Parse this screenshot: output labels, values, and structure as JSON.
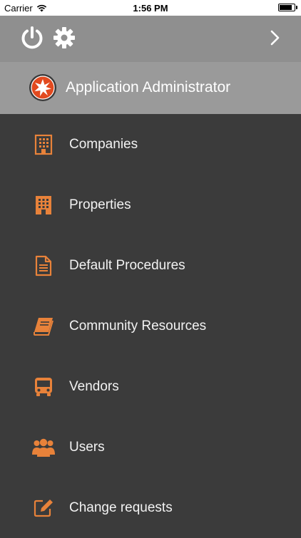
{
  "status_bar": {
    "carrier": "Carrier",
    "time": "1:56 PM",
    "battery_level": 0.85
  },
  "header": {
    "power_icon": "power-icon",
    "settings_icon": "gear-icon",
    "next_icon": "chevron-right-icon"
  },
  "profile": {
    "name": "Application Administrator",
    "avatar_icon": "starburst-logo-icon"
  },
  "menu": {
    "items": [
      {
        "label": "Companies",
        "icon": "office-building-icon"
      },
      {
        "label": "Properties",
        "icon": "apartment-building-icon"
      },
      {
        "label": "Default Procedures",
        "icon": "document-icon"
      },
      {
        "label": "Community Resources",
        "icon": "book-icon"
      },
      {
        "label": "Vendors",
        "icon": "bus-icon"
      },
      {
        "label": "Users",
        "icon": "users-icon"
      },
      {
        "label": "Change requests",
        "icon": "edit-icon"
      }
    ]
  },
  "colors": {
    "accent": "#e8823a",
    "menu_background": "#3b3b3b",
    "header_background": "#8f8f8f",
    "profile_background": "#9a9a9a"
  }
}
